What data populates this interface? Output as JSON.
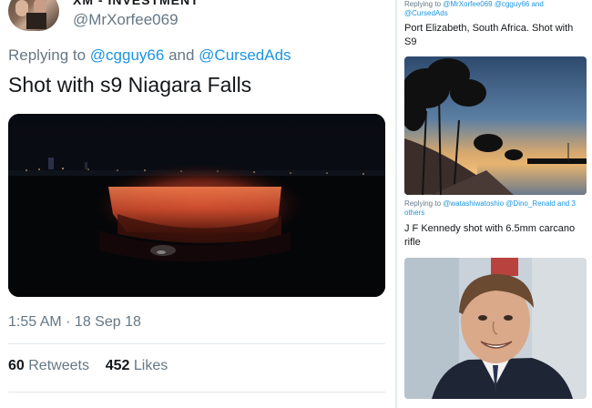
{
  "main_tweet": {
    "display_name": "XM - INVESTMENT",
    "handle": "@MrXorfee069",
    "replying_prefix": "Replying to",
    "replying_user1": "@cgguy66",
    "replying_and": "and",
    "replying_user2": "@CursedAds",
    "text": "Shot with s9 Niagara Falls",
    "timestamp": "1:55 AM · 18 Sep 18",
    "retweets_count": "60",
    "retweets_label": "Retweets",
    "likes_count": "452",
    "likes_label": "Likes"
  },
  "side_tweets": [
    {
      "replying_prefix": "Replying to",
      "replying_users": "@MrXorfee069 @cgguy66 and @CursedAds",
      "text": "Port Elizabeth, South Africa. Shot with S9"
    },
    {
      "replying_prefix": "Replying to",
      "replying_users": "@watashiwatoshio @Dino_Renald and 3 others",
      "text": "J F Kennedy shot with 6.5mm carcano rifle"
    }
  ],
  "colors": {
    "link": "#1b95e0",
    "secondary_text": "#657786",
    "primary_text": "#14171a"
  }
}
